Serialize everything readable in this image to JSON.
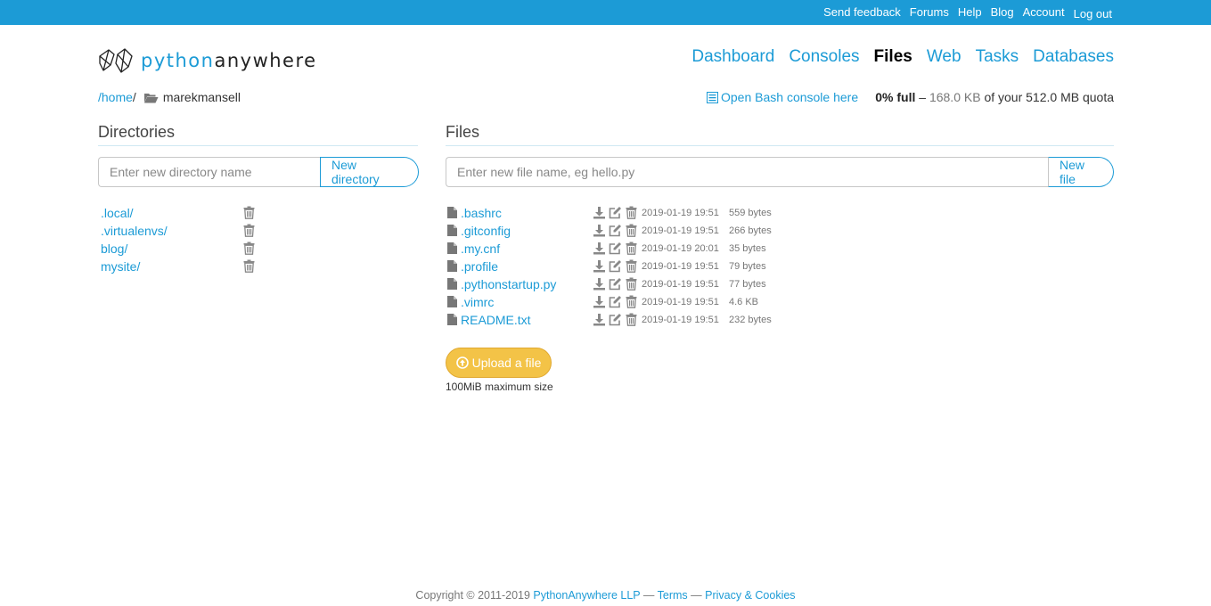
{
  "topbar": {
    "links": [
      "Send feedback",
      "Forums",
      "Help",
      "Blog",
      "Account",
      "Log out"
    ]
  },
  "logo": {
    "part1": "python",
    "part2": "anywhere"
  },
  "nav": {
    "items": [
      "Dashboard",
      "Consoles",
      "Files",
      "Web",
      "Tasks",
      "Databases"
    ],
    "active": "Files"
  },
  "breadcrumb": {
    "home": "/home",
    "sep": "/",
    "current": "marekmansell"
  },
  "bash_link": "Open Bash console here",
  "quota": {
    "percent": "0% full",
    "dash": " – ",
    "used": "168.0 KB",
    "rest": " of your 512.0 MB quota"
  },
  "directories": {
    "title": "Directories",
    "placeholder": "Enter new directory name",
    "button": "New directory",
    "items": [
      ".local/",
      ".virtualenvs/",
      "blog/",
      "mysite/"
    ]
  },
  "files": {
    "title": "Files",
    "placeholder": "Enter new file name, eg hello.py",
    "button": "New file",
    "items": [
      {
        "name": ".bashrc",
        "date": "2019-01-19 19:51",
        "size": "559 bytes"
      },
      {
        "name": ".gitconfig",
        "date": "2019-01-19 19:51",
        "size": "266 bytes"
      },
      {
        "name": ".my.cnf",
        "date": "2019-01-19 20:01",
        "size": "35 bytes"
      },
      {
        "name": ".profile",
        "date": "2019-01-19 19:51",
        "size": "79 bytes"
      },
      {
        "name": ".pythonstartup.py",
        "date": "2019-01-19 19:51",
        "size": "77 bytes"
      },
      {
        "name": ".vimrc",
        "date": "2019-01-19 19:51",
        "size": "4.6 KB"
      },
      {
        "name": "README.txt",
        "date": "2019-01-19 19:51",
        "size": "232 bytes"
      }
    ]
  },
  "upload": {
    "label": "Upload a file",
    "note": "100MiB maximum size"
  },
  "footer": {
    "copyright": "Copyright © 2011-2019 ",
    "company": "PythonAnywhere LLP",
    "sep1": " — ",
    "terms": "Terms",
    "sep2": " — ",
    "privacy": "Privacy & Cookies"
  },
  "colors": {
    "brand": "#1c9bd6",
    "upload": "#f3c347",
    "icon_gray": "#888888"
  },
  "icons": {
    "trash": "trash-icon",
    "download": "download-icon",
    "edit": "edit-icon",
    "file": "file-icon",
    "folder": "folder-open-icon",
    "console": "list-icon",
    "upload": "upload-circle-icon"
  }
}
